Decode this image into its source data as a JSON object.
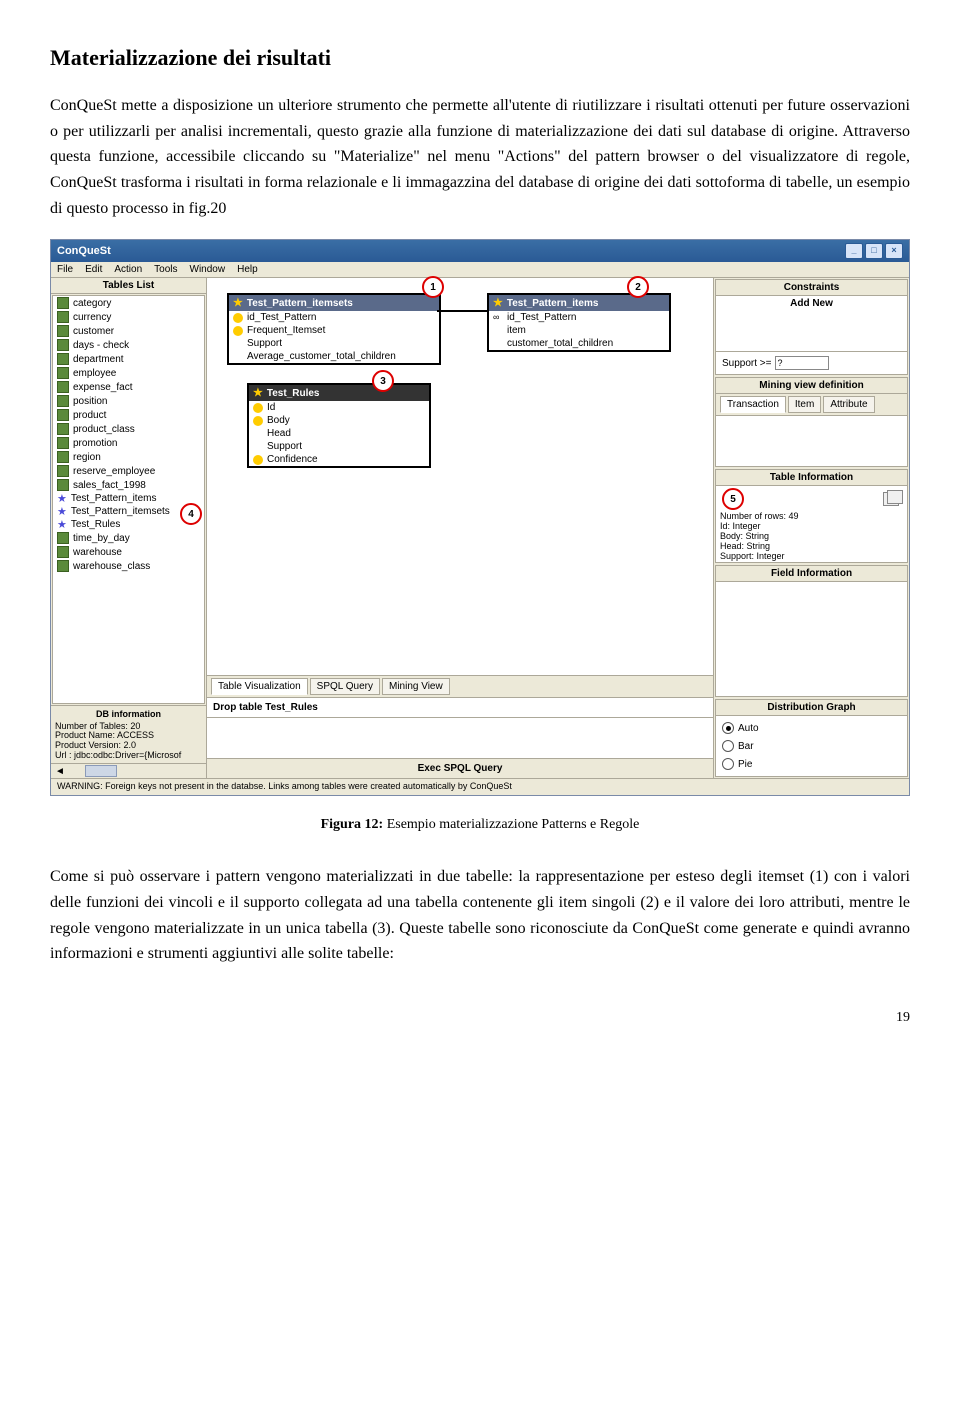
{
  "heading": "Materializzazione dei risultati",
  "para1": "ConQueSt mette a disposizione un ulteriore strumento che permette all'utente di riutilizzare i risultati ottenuti per future osservazioni o per utilizzarli per analisi incrementali, questo grazie alla funzione di materializzazione dei dati sul database di origine. Attraverso questa funzione, accessibile cliccando su \"Materialize\" nel menu \"Actions\" del pattern browser o del visualizzatore di regole, ConQueSt trasforma i risultati in forma relazionale e li immagazzina del database di origine dei dati sottoforma di tabelle, un esempio di questo processo in fig.20",
  "figcaption_bold": "Figura 12:",
  "figcaption_rest": " Esempio materializzazione Patterns e Regole",
  "para2": "Come si può osservare i pattern vengono materializzati in due tabelle: la rappresentazione per esteso degli itemset (1) con i valori delle funzioni dei vincoli e il supporto collegata ad una tabella contenente gli item singoli (2) e il valore dei loro attributi, mentre le regole vengono materializzate in un unica tabella (3). Queste tabelle sono riconosciute da ConQueSt come generate e quindi avranno informazioni e strumenti aggiuntivi alle solite tabelle:",
  "page_number": "19",
  "app": {
    "title": "ConQueSt",
    "menus": [
      "File",
      "Edit",
      "Action",
      "Tools",
      "Window",
      "Help"
    ],
    "left": {
      "tables_list_title": "Tables List",
      "tables": [
        {
          "name": "category",
          "type": "tbl"
        },
        {
          "name": "currency",
          "type": "tbl"
        },
        {
          "name": "customer",
          "type": "tbl"
        },
        {
          "name": "days - check",
          "type": "tbl"
        },
        {
          "name": "department",
          "type": "tbl"
        },
        {
          "name": "employee",
          "type": "tbl"
        },
        {
          "name": "expense_fact",
          "type": "tbl"
        },
        {
          "name": "position",
          "type": "tbl"
        },
        {
          "name": "product",
          "type": "tbl"
        },
        {
          "name": "product_class",
          "type": "tbl"
        },
        {
          "name": "promotion",
          "type": "tbl"
        },
        {
          "name": "region",
          "type": "tbl"
        },
        {
          "name": "reserve_employee",
          "type": "tbl"
        },
        {
          "name": "sales_fact_1998",
          "type": "tbl"
        },
        {
          "name": "Test_Pattern_items",
          "type": "star"
        },
        {
          "name": "Test_Pattern_itemsets",
          "type": "star"
        },
        {
          "name": "Test_Rules",
          "type": "star"
        },
        {
          "name": "time_by_day",
          "type": "tbl"
        },
        {
          "name": "warehouse",
          "type": "tbl"
        },
        {
          "name": "warehouse_class",
          "type": "tbl"
        }
      ],
      "dbinfo_title": "DB information",
      "dbinfo": [
        "Number of Tables: 20",
        "Product Name: ACCESS",
        "Product Version: 2.0",
        "Url : jdbc:odbc:Driver={Microsof"
      ]
    },
    "mid": {
      "box1": {
        "title": "Test_Pattern_itemsets",
        "rows": [
          "id_Test_Pattern",
          "Frequent_Itemset",
          "Support",
          "Average_customer_total_children"
        ]
      },
      "box2": {
        "title": "Test_Pattern_items",
        "rows": [
          "id_Test_Pattern",
          "item",
          "customer_total_children"
        ]
      },
      "box3": {
        "title": "Test_Rules",
        "rows": [
          "Id",
          "Body",
          "Head",
          "Support",
          "Confidence"
        ]
      },
      "tabs": [
        "Table Visualization",
        "SPQL Query",
        "Mining View"
      ],
      "drop_text": "Drop table Test_Rules",
      "exec_text": "Exec SPQL Query"
    },
    "right": {
      "constraints_title": "Constraints",
      "add_new": "Add New",
      "support_label": "Support >=",
      "support_val": "?",
      "mining_title": "Mining view definition",
      "mining_tabs": [
        "Transaction",
        "Item",
        "Attribute"
      ],
      "tableinfo_title": "Table Information",
      "tableinfo": [
        "Number of rows: 49",
        "Id: Integer",
        "Body: String",
        "Head: String",
        "Support: Integer"
      ],
      "fieldinfo_title": "Field Information",
      "dist_title": "Distribution Graph",
      "radios": [
        "Auto",
        "Bar",
        "Pie"
      ]
    },
    "statusbar": "WARNING: Foreign keys not present in the databse. Links among tables were created automatically by ConQueSt",
    "markers": {
      "m1": "1",
      "m2": "2",
      "m3": "3",
      "m4": "4",
      "m5": "5"
    }
  }
}
